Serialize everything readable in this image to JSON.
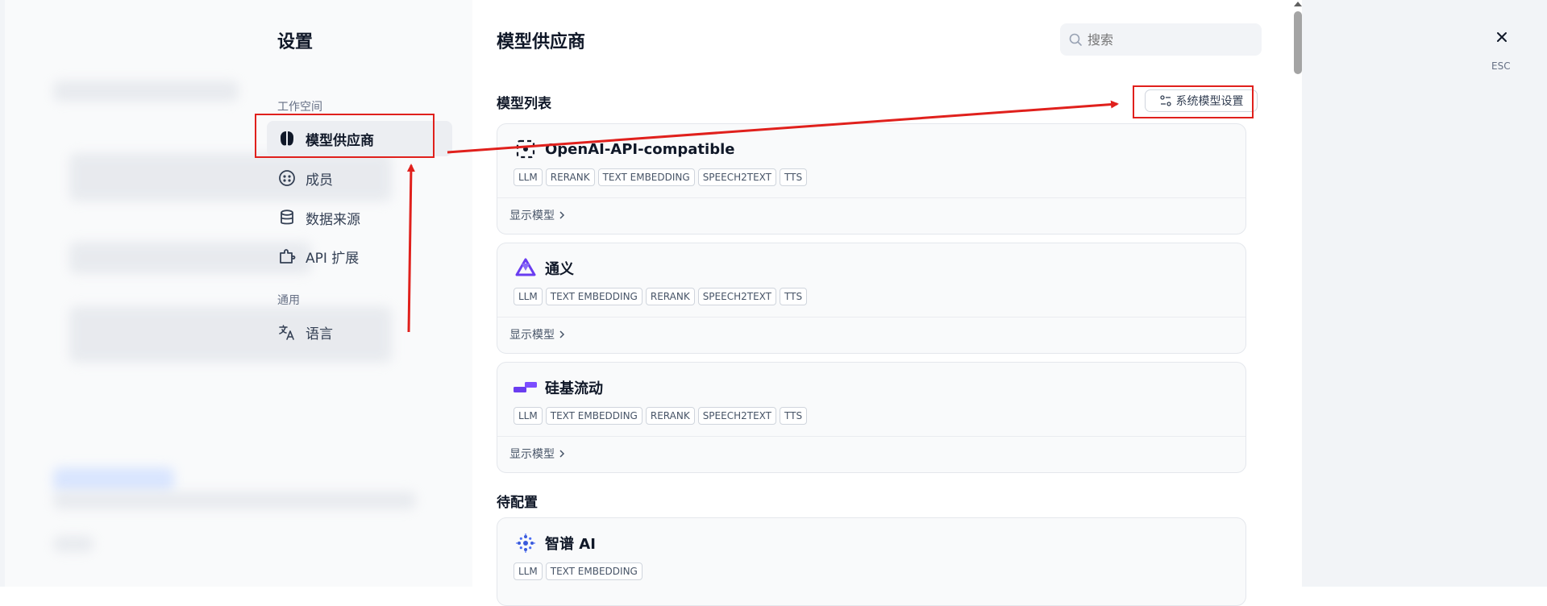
{
  "settings_title": "设置",
  "sections": {
    "workspace": "工作空间",
    "general": "通用"
  },
  "nav": [
    {
      "label": "模型供应商",
      "icon": "brain-icon",
      "active": true
    },
    {
      "label": "成员",
      "icon": "members-icon",
      "active": false
    },
    {
      "label": "数据来源",
      "icon": "database-icon",
      "active": false
    },
    {
      "label": "API 扩展",
      "icon": "puzzle-icon",
      "active": false
    },
    {
      "label": "语言",
      "icon": "translate-icon",
      "active": false
    }
  ],
  "content": {
    "title": "模型供应商",
    "search_placeholder": "搜索",
    "model_list_heading": "模型列表",
    "system_model_settings": "系统模型设置",
    "pending_heading": "待配置",
    "show_models": "显示模型"
  },
  "providers": [
    {
      "name": "OpenAI-API-compatible",
      "icon": "openai-compatible-icon",
      "tags": [
        "LLM",
        "RERANK",
        "TEXT EMBEDDING",
        "SPEECH2TEXT",
        "TTS"
      ]
    },
    {
      "name": "通义",
      "icon": "tongyi-icon",
      "tags": [
        "LLM",
        "TEXT EMBEDDING",
        "RERANK",
        "SPEECH2TEXT",
        "TTS"
      ]
    },
    {
      "name": "硅基流动",
      "icon": "siliconflow-icon",
      "tags": [
        "LLM",
        "TEXT EMBEDDING",
        "RERANK",
        "SPEECH2TEXT",
        "TTS"
      ]
    }
  ],
  "pending_providers": [
    {
      "name": "智谱 AI",
      "icon": "zhipu-icon",
      "tags": [
        "LLM",
        "TEXT EMBEDDING"
      ]
    }
  ],
  "close_label": "ESC",
  "colors": {
    "annotation_red": "#e0201c",
    "accent_purple": "#6a3df0",
    "zhipu_blue": "#3b5bdb"
  }
}
